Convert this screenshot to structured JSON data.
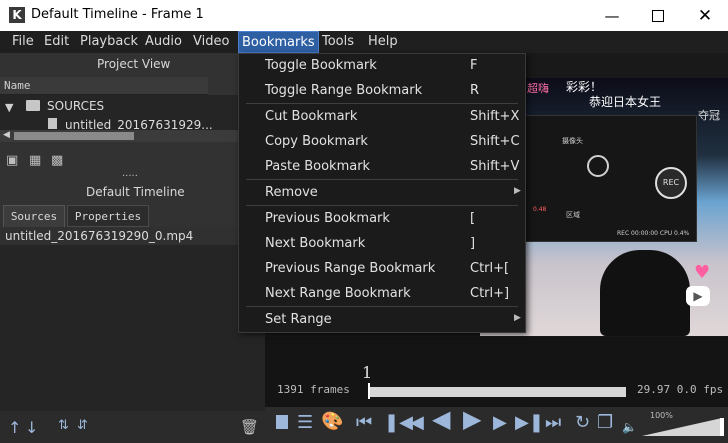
{
  "window": {
    "title": "Default Timeline - Frame 1",
    "logo_letter": "K",
    "min_icon": "minimize-icon",
    "max_icon": "maximize-icon",
    "close_icon": "close-icon"
  },
  "menubar": {
    "items": [
      "File",
      "Edit",
      "Playback",
      "Audio",
      "Video",
      "Bookmarks",
      "Tools",
      "Help"
    ],
    "active": "Bookmarks"
  },
  "project": {
    "title": "Project View",
    "column_name": "Name",
    "folder": "SOURCES",
    "file": "untitled_20167631929...",
    "ellipsis": ".....",
    "timeline_label": "Default Timeline"
  },
  "source_tabs": [
    "Sources",
    "Properties"
  ],
  "source_list": [
    "untitled_201676319290_0.mp4"
  ],
  "bookmarks_menu": {
    "items": [
      {
        "label": "Toggle Bookmark",
        "shortcut": "F"
      },
      {
        "label": "Toggle Range Bookmark",
        "shortcut": "R"
      },
      {
        "label": "Cut Bookmark",
        "shortcut": "Shift+X"
      },
      {
        "label": "Copy Bookmark",
        "shortcut": "Shift+C"
      },
      {
        "label": "Paste Bookmark",
        "shortcut": "Shift+V"
      },
      {
        "label": "Remove",
        "shortcut": "",
        "submenu": true
      },
      {
        "label": "Previous Bookmark",
        "shortcut": "["
      },
      {
        "label": "Next Bookmark",
        "shortcut": "]"
      },
      {
        "label": "Previous Range Bookmark",
        "shortcut": "Ctrl+["
      },
      {
        "label": "Next Range Bookmark",
        "shortcut": "Ctrl+]"
      },
      {
        "label": "Set Range",
        "shortcut": "",
        "submenu": true
      }
    ]
  },
  "video_overlay": {
    "text_top_left": "超嗨",
    "text_top_mid": "彩彩！",
    "text_line2": "恭迎日本女王",
    "text_right": "夺冠",
    "rec": "REC",
    "panel_label": "摄像头",
    "panel_sub": "区域",
    "panel_status": "REC 00:00:00   CPU 0.4%",
    "panel_val": "0.48"
  },
  "timeline": {
    "frame_number": "1",
    "frames_label": "1391 frames",
    "fps_readout": "29.97 0.0  fps",
    "zoom": "100%",
    "progress": 0.0
  },
  "colors": {
    "menu_highlight": "#2f5fa3",
    "transport_blue": "#9cb7d9"
  }
}
